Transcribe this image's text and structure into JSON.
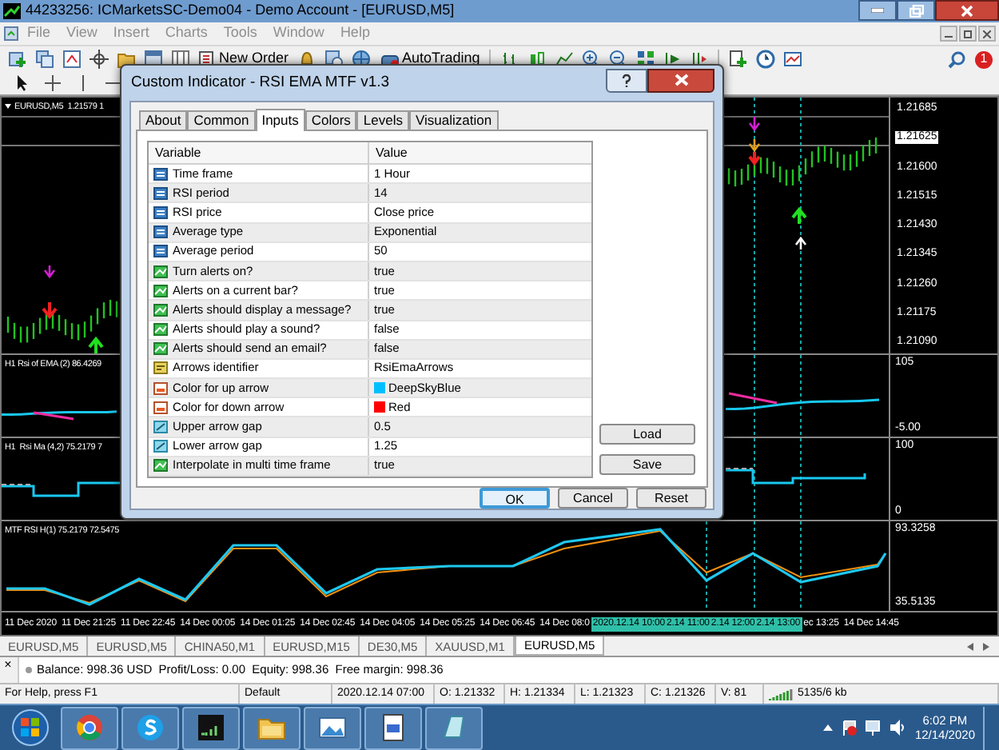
{
  "window": {
    "title": "44233256: ICMarketsSC-Demo04 - Demo Account - [EURUSD,M5]"
  },
  "menu": [
    {
      "label": "File",
      "disabled": true
    },
    {
      "label": "View",
      "disabled": true
    },
    {
      "label": "Insert",
      "disabled": true
    },
    {
      "label": "Charts",
      "disabled": true
    },
    {
      "label": "Tools",
      "disabled": true
    },
    {
      "label": "Window",
      "disabled": true
    },
    {
      "label": "Help",
      "disabled": true
    }
  ],
  "toolbar": {
    "buttons": [
      "New Order",
      "AutoTrading"
    ],
    "notification_count": "1"
  },
  "chart": {
    "symbol_label": "EURUSD,M5  1.21579 1",
    "price_axis": [
      {
        "label": "1.21685",
        "kind": "tick"
      },
      {
        "label": "1.21625",
        "kind": "current"
      },
      {
        "label": "1.21600",
        "kind": "tick"
      },
      {
        "label": "1.21515",
        "kind": "tick"
      },
      {
        "label": "1.21430",
        "kind": "tick"
      },
      {
        "label": "1.21345",
        "kind": "tick"
      },
      {
        "label": "1.21260",
        "kind": "tick"
      },
      {
        "label": "1.21175",
        "kind": "tick"
      },
      {
        "label": "1.21090",
        "kind": "tick"
      }
    ],
    "panes": [
      {
        "label": "H1 Rsi of EMA (2) 86.4269",
        "axis": [
          "105",
          "-5.00"
        ]
      },
      {
        "label": "H1  Rsi Ma (4,2) 75.2179 7",
        "axis": [
          "100",
          "0"
        ]
      },
      {
        "label": "MTF RSI H(1) 75.2179 72.5475",
        "axis": [
          "93.3258",
          "35.5135"
        ]
      }
    ],
    "time_axis": [
      {
        "label": "11 Dec 2020",
        "kind": "tick"
      },
      {
        "label": "11 Dec 21:25",
        "kind": "tick"
      },
      {
        "label": "11 Dec 22:45",
        "kind": "tick"
      },
      {
        "label": "14 Dec 00:05",
        "kind": "tick"
      },
      {
        "label": "14 Dec 01:25",
        "kind": "tick"
      },
      {
        "label": "14 Dec 02:45",
        "kind": "tick"
      },
      {
        "label": "14 Dec 04:05",
        "kind": "tick"
      },
      {
        "label": "14 Dec 05:25",
        "kind": "tick"
      },
      {
        "label": "14 Dec 06:45",
        "kind": "tick"
      },
      {
        "label": "14 Dec 08:0",
        "kind": "tick"
      },
      {
        "label": "2020.12.14 10:00",
        "kind": "marker"
      },
      {
        "label": "2.14 11:00",
        "kind": "marker"
      },
      {
        "label": "2.14 12:00",
        "kind": "marker"
      },
      {
        "label": "2.14 13:00",
        "kind": "marker"
      },
      {
        "label": "ec 13:25",
        "kind": "tick"
      },
      {
        "label": "14 Dec 14:45",
        "kind": "tick"
      }
    ]
  },
  "chart_tabs": [
    {
      "label": "EURUSD,M5",
      "selected": false
    },
    {
      "label": "EURUSD,M5",
      "selected": false
    },
    {
      "label": "CHINA50,M1",
      "selected": false
    },
    {
      "label": "EURUSD,M15",
      "selected": false
    },
    {
      "label": "DE30,M5",
      "selected": false
    },
    {
      "label": "XAUUSD,M1",
      "selected": false
    },
    {
      "label": "EURUSD,M5",
      "selected": true
    }
  ],
  "terminal": {
    "close_glyph": "×",
    "summary": "Balance: 998.36 USD  Profit/Loss: 0.00  Equity: 998.36  Free margin: 998.36"
  },
  "status_bar": [
    "For Help, press F1",
    "Default",
    "2020.12.14 07:00",
    "O: 1.21332",
    "H: 1.21334",
    "L: 1.21323",
    "C: 1.21326",
    "V: 81",
    "5135/6 kb"
  ],
  "taskbar": {
    "time": "6:02 PM",
    "date": "12/14/2020"
  },
  "dialog": {
    "title": "Custom Indicator - RSI EMA MTF v1.3",
    "tabs": [
      {
        "label": "About",
        "selected": false
      },
      {
        "label": "Common",
        "selected": false
      },
      {
        "label": "Inputs",
        "selected": true
      },
      {
        "label": "Colors",
        "selected": false
      },
      {
        "label": "Levels",
        "selected": false
      },
      {
        "label": "Visualization",
        "selected": false
      }
    ],
    "columns": [
      "Variable",
      "Value"
    ],
    "rows": [
      {
        "kind": "int",
        "variable": "Time frame",
        "value": "1 Hour"
      },
      {
        "kind": "int",
        "variable": "RSI period",
        "value": "14"
      },
      {
        "kind": "int",
        "variable": "RSI price",
        "value": "Close price"
      },
      {
        "kind": "int",
        "variable": "Average type",
        "value": "Exponential"
      },
      {
        "kind": "int",
        "variable": "Average period",
        "value": "50"
      },
      {
        "kind": "bool",
        "variable": "Turn alerts on?",
        "value": "true"
      },
      {
        "kind": "bool",
        "variable": "Alerts on a current bar?",
        "value": "true"
      },
      {
        "kind": "bool",
        "variable": "Alerts should display a message?",
        "value": "true"
      },
      {
        "kind": "bool",
        "variable": "Alerts should play a sound?",
        "value": "false"
      },
      {
        "kind": "bool",
        "variable": "Alerts should send an email?",
        "value": "false"
      },
      {
        "kind": "string",
        "variable": "Arrows identifier",
        "value": "RsiEmaArrows"
      },
      {
        "kind": "color",
        "variable": "Color for up arrow",
        "value": "DeepSkyBlue",
        "color": "#00bfff"
      },
      {
        "kind": "color",
        "variable": "Color for down arrow",
        "value": "Red",
        "color": "#ff0000"
      },
      {
        "kind": "double",
        "variable": "Upper arrow gap",
        "value": "0.5"
      },
      {
        "kind": "double",
        "variable": "Lower arrow gap",
        "value": "1.25"
      },
      {
        "kind": "bool",
        "variable": "Interpolate in multi time frame",
        "value": "true"
      }
    ],
    "side_buttons": [
      "Load",
      "Save"
    ],
    "buttons": [
      {
        "label": "OK",
        "default": true
      },
      {
        "label": "Cancel",
        "default": false
      },
      {
        "label": "Reset",
        "default": false
      }
    ]
  }
}
